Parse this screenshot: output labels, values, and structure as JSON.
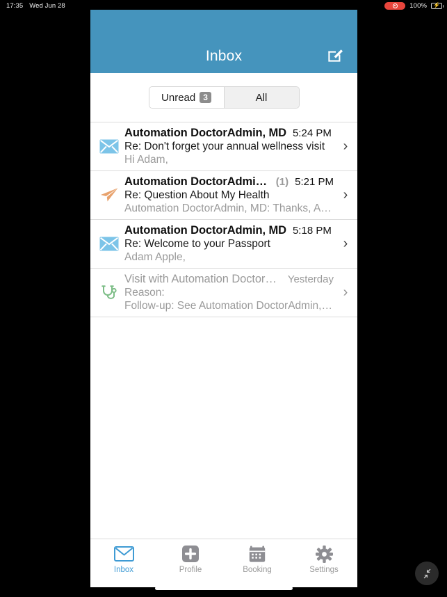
{
  "status_bar": {
    "time": "17:35",
    "date": "Wed Jun 28",
    "recording_icon": "record-indicator-icon",
    "battery_percent": "100%",
    "battery_icon": "battery-charging-icon"
  },
  "header": {
    "title": "Inbox",
    "compose_icon": "compose-icon",
    "background_color": "#4594bd"
  },
  "filter": {
    "unread_label": "Unread",
    "unread_count": "3",
    "all_label": "All",
    "selected": "Unread"
  },
  "messages": [
    {
      "icon": "envelope-icon",
      "icon_color": "#7cc4e8",
      "sender": "Automation DoctorAdmin, MD",
      "count": "",
      "time": "5:24 PM",
      "subject": "Re: Don't forget your annual wellness visit",
      "preview": "Hi Adam,",
      "state": "unread",
      "chevron_icon": "chevron-right-icon"
    },
    {
      "icon": "paper-plane-icon",
      "icon_color": "#e8a26d",
      "sender": "Automation DoctorAdmin, MD",
      "count": "(1)",
      "time": "5:21 PM",
      "subject": "Re: Question About My Health",
      "preview": "Automation DoctorAdmin, MD: Thanks, Adam.",
      "state": "unread",
      "chevron_icon": "chevron-right-icon"
    },
    {
      "icon": "envelope-icon",
      "icon_color": "#7cc4e8",
      "sender": "Automation DoctorAdmin, MD",
      "count": "",
      "time": "5:18 PM",
      "subject": "Re: Welcome to your Passport",
      "preview": "Adam Apple,",
      "state": "unread",
      "chevron_icon": "chevron-right-icon"
    },
    {
      "icon": "stethoscope-icon",
      "icon_color": "#7cbd86",
      "sender": "Visit with Automation DoctorAd...",
      "count": "",
      "time": "Yesterday",
      "subject": "Reason:",
      "preview": "Follow-up: See Automation DoctorAdmin, MD...",
      "state": "read",
      "chevron_icon": "chevron-right-icon"
    }
  ],
  "tabs": [
    {
      "label": "Inbox",
      "icon": "envelope-outline-icon",
      "active": true
    },
    {
      "label": "Profile",
      "icon": "profile-plus-icon",
      "active": false
    },
    {
      "label": "Booking",
      "icon": "calendar-icon",
      "active": false
    },
    {
      "label": "Settings",
      "icon": "gear-icon",
      "active": false
    }
  ],
  "collapse_button": {
    "icon": "collapse-arrows-icon"
  }
}
